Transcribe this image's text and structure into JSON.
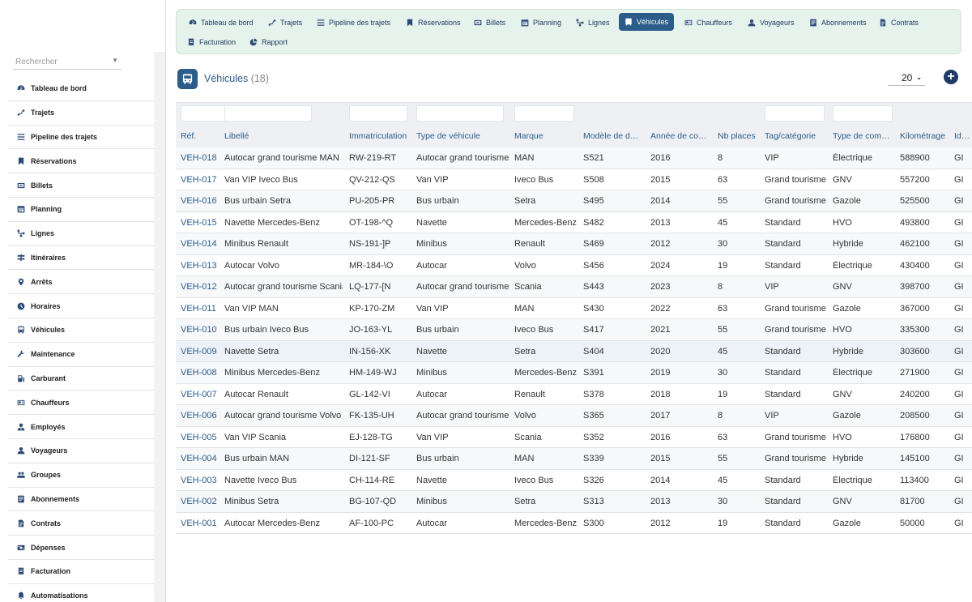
{
  "search": {
    "placeholder": "Rechercher"
  },
  "topnav": [
    {
      "label": "Tableau de bord",
      "icon": "gauge-icon"
    },
    {
      "label": "Trajets",
      "icon": "route-icon"
    },
    {
      "label": "Pipeline des trajets",
      "icon": "list-icon"
    },
    {
      "label": "Réservations",
      "icon": "bookmark-icon"
    },
    {
      "label": "Billets",
      "icon": "ticket-icon"
    },
    {
      "label": "Planning",
      "icon": "calendar-icon"
    },
    {
      "label": "Lignes",
      "icon": "network-icon"
    },
    {
      "label": "Véhicules",
      "icon": "bus-icon"
    },
    {
      "label": "Chauffeurs",
      "icon": "id-card-icon"
    },
    {
      "label": "Voyageurs",
      "icon": "user-icon"
    },
    {
      "label": "Abonnements",
      "icon": "subscription-icon"
    },
    {
      "label": "Contrats",
      "icon": "file-icon"
    },
    {
      "label": "Facturation",
      "icon": "invoice-icon"
    },
    {
      "label": "Rapport",
      "icon": "pie-chart-icon"
    }
  ],
  "sidebar": {
    "items": [
      {
        "label": "Tableau de bord",
        "icon": "gauge-icon"
      },
      {
        "label": "Trajets",
        "icon": "route-icon"
      },
      {
        "label": "Pipeline des trajets",
        "icon": "list-icon"
      },
      {
        "label": "Réservations",
        "icon": "bookmark-icon"
      },
      {
        "label": "Billets",
        "icon": "ticket-icon"
      },
      {
        "label": "Planning",
        "icon": "calendar-icon"
      },
      {
        "label": "Lignes",
        "icon": "network-icon"
      },
      {
        "label": "Itinéraires",
        "icon": "signpost-icon"
      },
      {
        "label": "Arrêts",
        "icon": "map-pin-icon"
      },
      {
        "label": "Horaires",
        "icon": "clock-icon"
      },
      {
        "label": "Véhicules",
        "icon": "bus-icon"
      },
      {
        "label": "Maintenance",
        "icon": "wrench-icon"
      },
      {
        "label": "Carburant",
        "icon": "fuel-icon"
      },
      {
        "label": "Chauffeurs",
        "icon": "id-card-icon"
      },
      {
        "label": "Employés",
        "icon": "user-tie-icon"
      },
      {
        "label": "Voyageurs",
        "icon": "user-icon"
      },
      {
        "label": "Groupes",
        "icon": "users-icon"
      },
      {
        "label": "Abonnements",
        "icon": "subscription-icon"
      },
      {
        "label": "Contrats",
        "icon": "file-icon"
      },
      {
        "label": "Dépenses",
        "icon": "money-icon"
      },
      {
        "label": "Facturation",
        "icon": "invoice-icon"
      },
      {
        "label": "Automatisations",
        "icon": "bell-icon"
      }
    ]
  },
  "page": {
    "title": "Véhicules",
    "count": "(18)",
    "page_size": "20",
    "add_label": "+"
  },
  "table": {
    "columns": [
      "Réf.",
      "Libellé",
      "Immatriculation",
      "Type de véhicule",
      "Marque",
      "Modèle de d…",
      "Année de co…",
      "Nb places",
      "Tag/catégorie",
      "Type de com…",
      "Kilométrage",
      "Id…"
    ],
    "rows": [
      [
        "VEH-018",
        "Autocar grand tourisme MAN",
        "RW-219-RT",
        "Autocar grand tourisme",
        "MAN",
        "S521",
        "2016",
        "8",
        "VIP",
        "Électrique",
        "588900",
        "GI"
      ],
      [
        "VEH-017",
        "Van VIP Iveco Bus",
        "QV-212-QS",
        "Van VIP",
        "Iveco Bus",
        "S508",
        "2015",
        "63",
        "Grand tourisme",
        "GNV",
        "557200",
        "GI"
      ],
      [
        "VEH-016",
        "Bus urbain Setra",
        "PU-205-PR",
        "Bus urbain",
        "Setra",
        "S495",
        "2014",
        "55",
        "Grand tourisme",
        "Gazole",
        "525500",
        "GI"
      ],
      [
        "VEH-015",
        "Navette Mercedes-Benz",
        "OT-198-^Q",
        "Navette",
        "Mercedes-Benz",
        "S482",
        "2013",
        "45",
        "Standard",
        "HVO",
        "493800",
        "GI"
      ],
      [
        "VEH-014",
        "Minibus Renault",
        "NS-191-]P",
        "Minibus",
        "Renault",
        "S469",
        "2012",
        "30",
        "Standard",
        "Hybride",
        "462100",
        "GI"
      ],
      [
        "VEH-013",
        "Autocar Volvo",
        "MR-184-\\O",
        "Autocar",
        "Volvo",
        "S456",
        "2024",
        "19",
        "Standard",
        "Électrique",
        "430400",
        "GI"
      ],
      [
        "VEH-012",
        "Autocar grand tourisme Scania",
        "LQ-177-[N",
        "Autocar grand tourisme",
        "Scania",
        "S443",
        "2023",
        "8",
        "VIP",
        "GNV",
        "398700",
        "GI"
      ],
      [
        "VEH-011",
        "Van VIP MAN",
        "KP-170-ZM",
        "Van VIP",
        "MAN",
        "S430",
        "2022",
        "63",
        "Grand tourisme",
        "Gazole",
        "367000",
        "GI"
      ],
      [
        "VEH-010",
        "Bus urbain Iveco Bus",
        "JO-163-YL",
        "Bus urbain",
        "Iveco Bus",
        "S417",
        "2021",
        "55",
        "Grand tourisme",
        "HVO",
        "335300",
        "GI"
      ],
      [
        "VEH-009",
        "Navette Setra",
        "IN-156-XK",
        "Navette",
        "Setra",
        "S404",
        "2020",
        "45",
        "Standard",
        "Hybride",
        "303600",
        "GI"
      ],
      [
        "VEH-008",
        "Minibus Mercedes-Benz",
        "HM-149-WJ",
        "Minibus",
        "Mercedes-Benz",
        "S391",
        "2019",
        "30",
        "Standard",
        "Électrique",
        "271900",
        "GI"
      ],
      [
        "VEH-007",
        "Autocar Renault",
        "GL-142-VI",
        "Autocar",
        "Renault",
        "S378",
        "2018",
        "19",
        "Standard",
        "GNV",
        "240200",
        "GI"
      ],
      [
        "VEH-006",
        "Autocar grand tourisme Volvo",
        "FK-135-UH",
        "Autocar grand tourisme",
        "Volvo",
        "S365",
        "2017",
        "8",
        "VIP",
        "Gazole",
        "208500",
        "GI"
      ],
      [
        "VEH-005",
        "Van VIP Scania",
        "EJ-128-TG",
        "Van VIP",
        "Scania",
        "S352",
        "2016",
        "63",
        "Grand tourisme",
        "HVO",
        "176800",
        "GI"
      ],
      [
        "VEH-004",
        "Bus urbain MAN",
        "DI-121-SF",
        "Bus urbain",
        "MAN",
        "S339",
        "2015",
        "55",
        "Grand tourisme",
        "Hybride",
        "145100",
        "GI"
      ],
      [
        "VEH-003",
        "Navette Iveco Bus",
        "CH-114-RE",
        "Navette",
        "Iveco Bus",
        "S326",
        "2014",
        "45",
        "Standard",
        "Électrique",
        "113400",
        "GI"
      ],
      [
        "VEH-002",
        "Minibus Setra",
        "BG-107-QD",
        "Minibus",
        "Setra",
        "S313",
        "2013",
        "30",
        "Standard",
        "GNV",
        "81700",
        "GI"
      ],
      [
        "VEH-001",
        "Autocar Mercedes-Benz",
        "AF-100-PC",
        "Autocar",
        "Mercedes-Benz",
        "S300",
        "2012",
        "19",
        "Standard",
        "Gazole",
        "50000",
        "GI"
      ]
    ]
  },
  "colors": {
    "accent": "#2b5c8a",
    "nav_bg": "#e6f2ec",
    "text": "#333333"
  }
}
